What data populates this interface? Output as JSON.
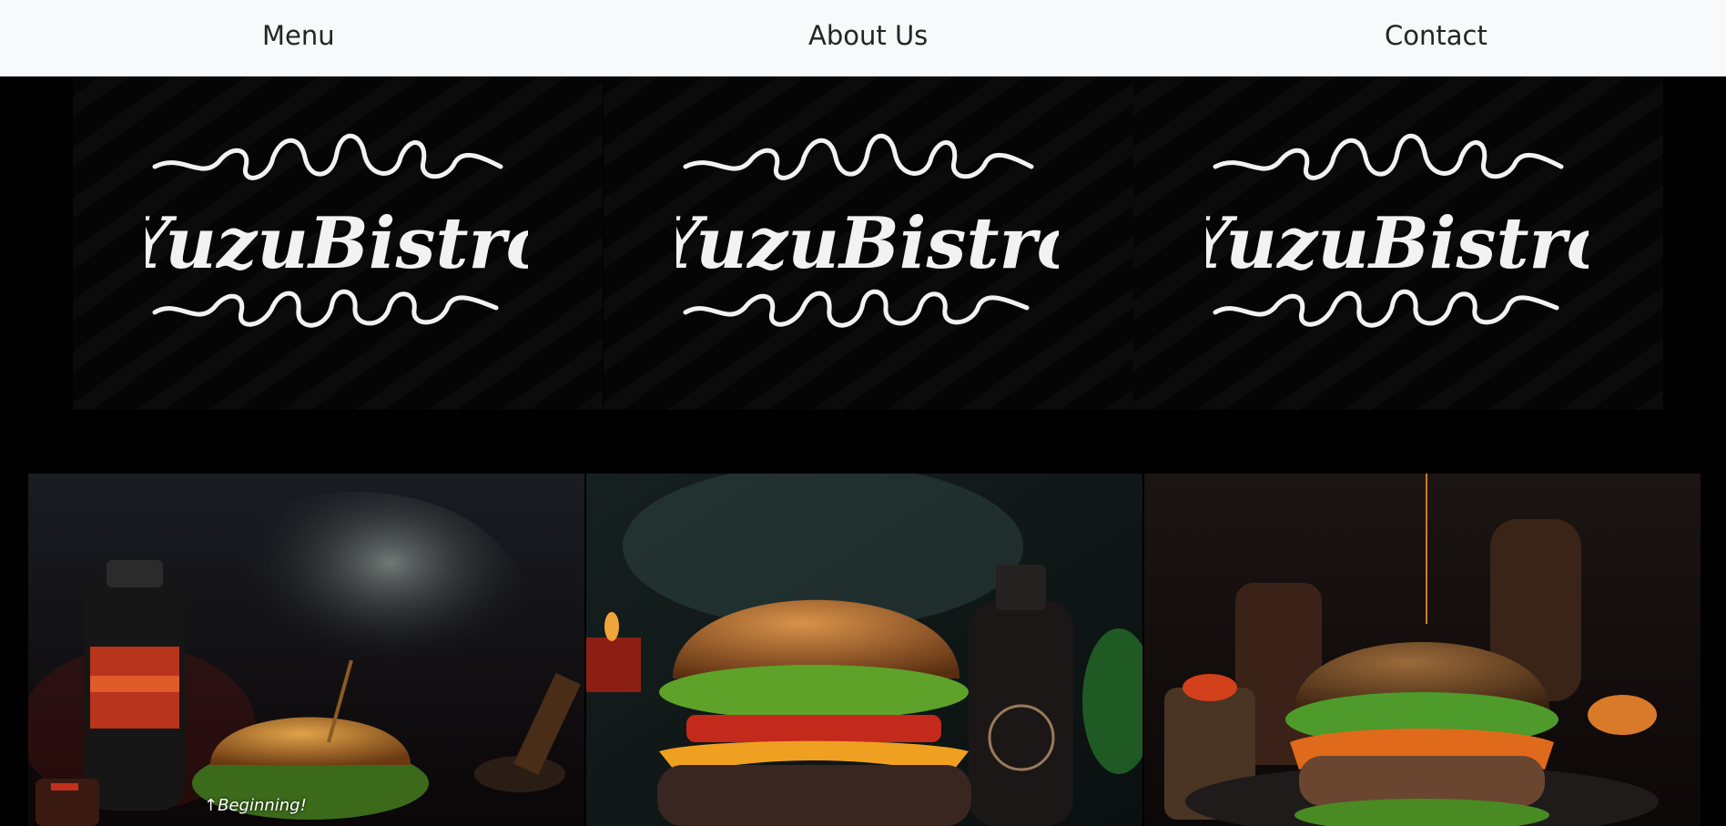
{
  "nav": {
    "items": [
      {
        "label": "Menu"
      },
      {
        "label": "About Us"
      },
      {
        "label": "Contact"
      }
    ]
  },
  "logo": {
    "text": "YuzuBistro"
  },
  "photos": [
    {
      "subject": "burger with smoke and red bottle"
    },
    {
      "subject": "cheeseburger with sauce bottle"
    },
    {
      "subject": "burger with orange cheese on plate"
    }
  ],
  "back_link": {
    "arrow": "↑",
    "label": "Beginning!"
  },
  "colors": {
    "nav_background": "#f8f9fa",
    "page_background": "#000000",
    "nav_text": "#212529",
    "logo_text": "#f2f2f2"
  }
}
